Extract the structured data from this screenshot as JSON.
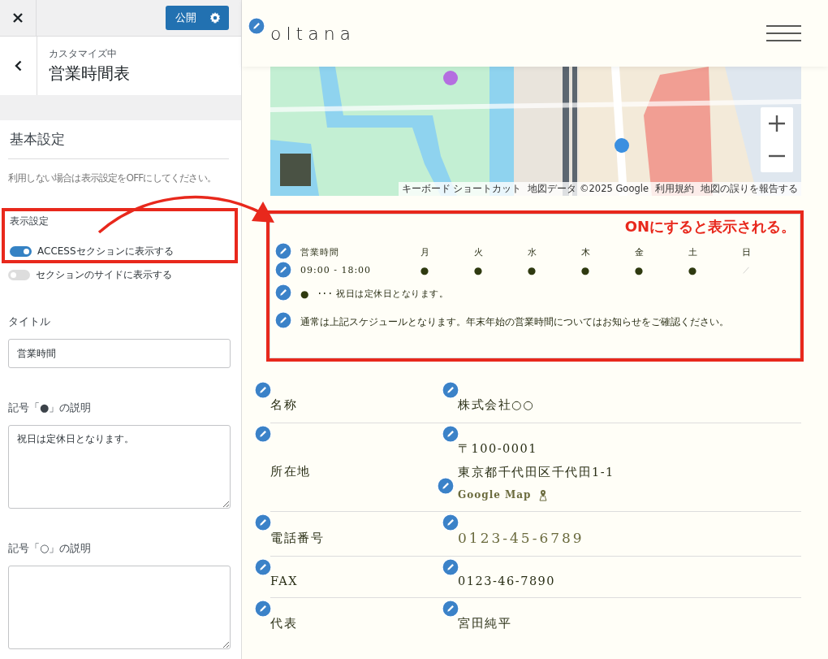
{
  "sidebar": {
    "publish_button": "公開",
    "breadcrumb": "カスタマイズ中",
    "panel_title": "営業時間表",
    "section_title": "基本設定",
    "note": "利用しない場合は表示設定をOFFにしてください。",
    "display_label": "表示設定",
    "toggles": [
      {
        "label": "ACCESSセクションに表示する",
        "on": true
      },
      {
        "label": "セクションのサイドに表示する",
        "on": false
      }
    ],
    "fields": [
      {
        "label": "タイトル",
        "kind": "input",
        "value": "営業時間"
      },
      {
        "label": "記号「●」の説明",
        "kind": "textarea",
        "value": "祝日は定休日となります。"
      },
      {
        "label": "記号「○」の説明",
        "kind": "textarea"
      }
    ]
  },
  "annotation": "ONにすると表示される。",
  "site": {
    "logo": "oltana",
    "map": {
      "kind": "picture",
      "attribution": [
        "キーボード ショートカット",
        "地図データ ©2025 Google",
        "利用規約",
        "地図の誤りを報告する"
      ]
    },
    "hours": {
      "heading": "営業時間",
      "time": "09:00 - 18:00",
      "days": [
        {
          "day": "月",
          "symbol": "●",
          "closed": false
        },
        {
          "day": "火",
          "symbol": "●",
          "closed": false
        },
        {
          "day": "水",
          "symbol": "●",
          "closed": false
        },
        {
          "day": "木",
          "symbol": "●",
          "closed": false
        },
        {
          "day": "金",
          "symbol": "●",
          "closed": false
        },
        {
          "day": "土",
          "symbol": "●",
          "closed": false
        },
        {
          "day": "日",
          "symbol": "／",
          "closed": true
        }
      ],
      "legend_symbol": "●",
      "legend_text": "･･･ 祝日は定休日となります。",
      "note": "通常は上記スケジュールとなります。年末年始の営業時間についてはお知らせをご確認ください。"
    },
    "info": [
      {
        "label": "名称",
        "kind": "text",
        "values": [
          "株式会社○○"
        ]
      },
      {
        "label": "所在地",
        "kind": "text",
        "values": [
          "〒100-0001",
          "東京都千代田区千代田1-1"
        ],
        "link": "Google Map"
      },
      {
        "label": "電話番号",
        "kind": "tel",
        "values": [
          "0123-45-6789"
        ]
      },
      {
        "label": "FAX",
        "kind": "text",
        "values": [
          "0123-46-7890"
        ]
      },
      {
        "label": "代表",
        "kind": "text",
        "values": [
          "宮田純平"
        ]
      }
    ]
  }
}
